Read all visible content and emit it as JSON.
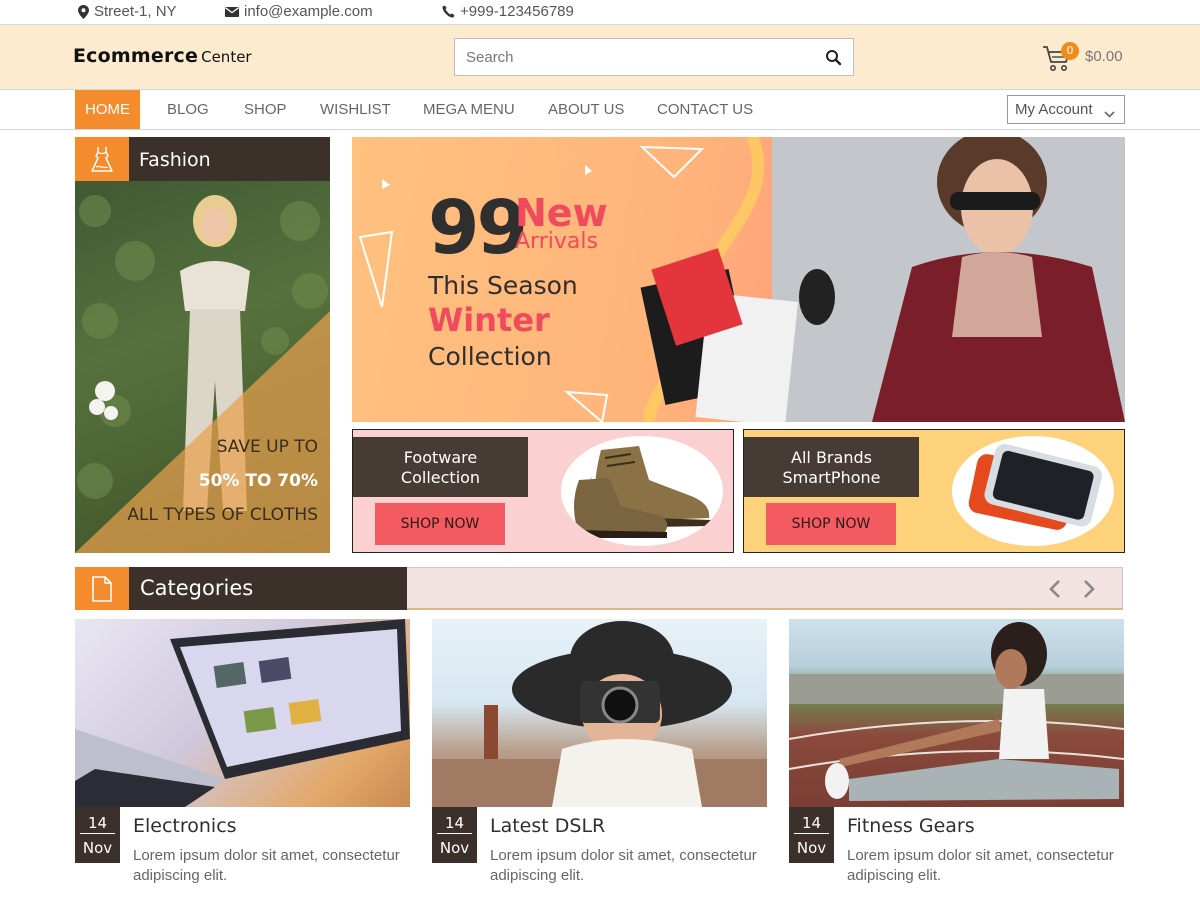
{
  "topbar": {
    "address": "Street-1, NY",
    "email": "info@example.com",
    "phone": "+999-123456789"
  },
  "header": {
    "logo_bold": "Ecommerce",
    "logo_rest": "Center",
    "search_placeholder": "Search",
    "cart_count": "0",
    "cart_total": "$0.00"
  },
  "nav": {
    "items": [
      "HOME",
      "BLOG",
      "SHOP",
      "WISHLIST",
      "MEGA MENU",
      "ABOUT US",
      "CONTACT US"
    ],
    "active": "HOME",
    "account_label": "My Account"
  },
  "fashion": {
    "title": "Fashion",
    "promo_line1": "SAVE UP TO",
    "promo_line2": "50% TO 70%",
    "promo_line3": "ALL TYPES OF CLOTHS"
  },
  "hero": {
    "number": "99",
    "new": "New",
    "arrivals": "Arrivals",
    "season": "This Season",
    "winter": "Winter",
    "collection": "Collection"
  },
  "promos": [
    {
      "line1": "Footware",
      "line2": "Collection",
      "button": "SHOP NOW",
      "bg": "#fbd0d0"
    },
    {
      "line1": "All Brands",
      "line2": "SmartPhone",
      "button": "SHOP NOW",
      "bg": "#fdd27a"
    }
  ],
  "categories": {
    "title": "Categories",
    "cards": [
      {
        "day": "14",
        "month": "Nov",
        "title": "Electronics",
        "desc": "Lorem ipsum dolor sit amet, consectetur adipiscing elit."
      },
      {
        "day": "14",
        "month": "Nov",
        "title": "Latest DSLR",
        "desc": "Lorem ipsum dolor sit amet, consectetur adipiscing elit."
      },
      {
        "day": "14",
        "month": "Nov",
        "title": "Fitness Gears",
        "desc": "Lorem ipsum dolor sit amet, consectetur adipiscing elit."
      }
    ]
  },
  "colors": {
    "accent": "#f48b2c",
    "dark": "#3b302a",
    "header_bg": "#fdebcf",
    "pink": "#f04a5c"
  },
  "icons": [
    "location-pin-icon",
    "mail-icon",
    "phone-icon",
    "search-icon",
    "cart-icon",
    "chevron-down-icon",
    "dress-icon",
    "page-icon",
    "arrow-left-icon",
    "arrow-right-icon"
  ]
}
